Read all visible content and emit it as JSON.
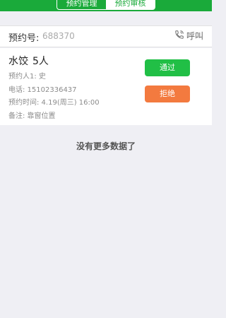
{
  "tabs": [
    {
      "label": "预约管理",
      "active": false
    },
    {
      "label": "预约审核",
      "active": true
    }
  ],
  "order": {
    "label": "预约号:",
    "number": "688370",
    "call_label": "呼叫"
  },
  "reservation": {
    "dish": "水饺",
    "people": "5人",
    "reserver": "预约人1: 史",
    "phone": "电话: 15102336437",
    "time": "预约时间: 4.19(周三) 16:00",
    "note": "备注: 靠窗位置"
  },
  "actions": {
    "approve": "通过",
    "reject": "拒绝"
  },
  "footer": {
    "no_more": "没有更多数据了"
  },
  "colors": {
    "header_green": "#1aaa3a",
    "approve_green": "#21bf46",
    "reject_orange": "#f37a3f"
  },
  "icons": {
    "call": "phone-icon"
  }
}
